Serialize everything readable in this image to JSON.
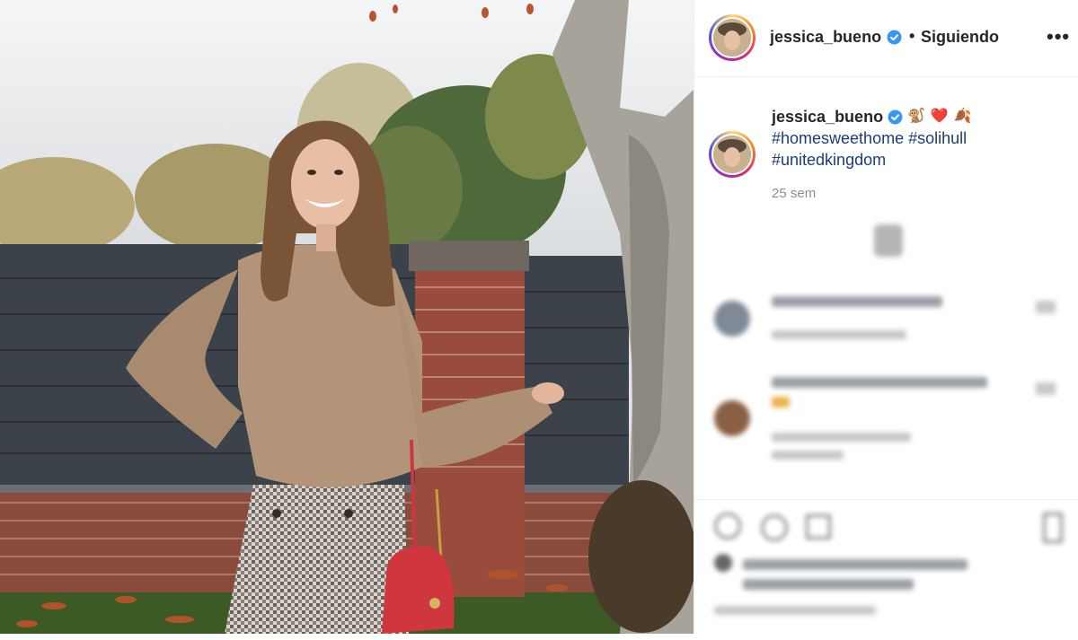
{
  "post": {
    "username": "jessica_bueno",
    "follow_status": "Siguiendo",
    "separator": "•",
    "more_label": "•••"
  },
  "caption": {
    "username": "jessica_bueno",
    "emojis": "🐒❤️🍂",
    "line1": "#homesweethome #solihull",
    "line2": "#unitedkingdom",
    "time": "25 sem"
  },
  "colors": {
    "verified_blue": "#3897f0",
    "hashtag_blue": "#1a3e77",
    "meta_gray": "#8e8e8e"
  }
}
